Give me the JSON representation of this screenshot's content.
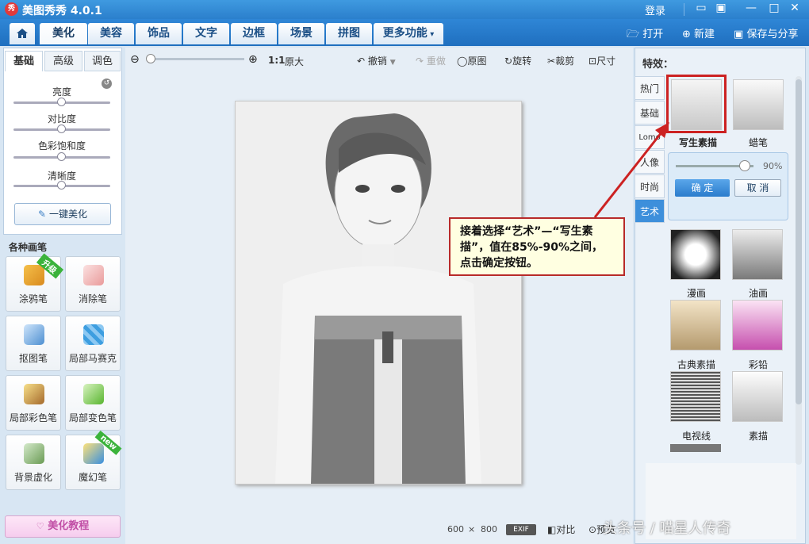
{
  "app": {
    "title": "美图秀秀 4.0.1",
    "logo": "秀"
  },
  "window": {
    "login": "登录"
  },
  "tabs": [
    "美化",
    "美容",
    "饰品",
    "文字",
    "边框",
    "场景",
    "拼图",
    "更多功能"
  ],
  "actions": {
    "open": "打开",
    "new": "新建",
    "save": "保存与分享"
  },
  "left": {
    "tabs": [
      "基础",
      "高级",
      "调色"
    ],
    "sliders": [
      {
        "label": "亮度",
        "value": 0.5
      },
      {
        "label": "对比度",
        "value": 0.5
      },
      {
        "label": "色彩饱和度",
        "value": 0.5
      },
      {
        "label": "清晰度",
        "value": 0.5
      }
    ],
    "one_click": "一键美化",
    "brush_title": "各种画笔",
    "brushes": [
      {
        "label": "涂鸦笔",
        "badge": "升级"
      },
      {
        "label": "消除笔",
        "badge": ""
      },
      {
        "label": "抠图笔",
        "badge": ""
      },
      {
        "label": "局部马赛克",
        "badge": ""
      },
      {
        "label": "局部彩色笔",
        "badge": ""
      },
      {
        "label": "局部变色笔",
        "badge": ""
      },
      {
        "label": "背景虚化",
        "badge": ""
      },
      {
        "label": "魔幻笔",
        "badge": "new"
      }
    ],
    "tutorial": "美化教程"
  },
  "toolbar": {
    "ratio": "1:1",
    "original_size": "原大",
    "undo": "撤销",
    "redo": "重做",
    "original": "原图",
    "rotate": "旋转",
    "crop": "裁剪",
    "size": "尺寸"
  },
  "status": {
    "width": "600",
    "times": "×",
    "height": "800",
    "exif": "EXIF",
    "compare": "对比",
    "preview": "预览"
  },
  "right": {
    "title": "特效：",
    "categories": [
      "热门",
      "基础",
      "Lomo",
      "人像",
      "时尚",
      "艺术"
    ],
    "effects_top": [
      "写生素描",
      "蜡笔"
    ],
    "intensity": "90%",
    "intensity_value": 0.9,
    "confirm": "确 定",
    "cancel": "取 消",
    "effects": [
      "漫画",
      "油画",
      "古典素描",
      "彩铅",
      "电视线",
      "素描"
    ]
  },
  "callout": "接着选择“艺术”—“写生素描”，值在85%-90%之间，点击确定按钮。",
  "watermark": "头条号 / 喵星人传奇"
}
